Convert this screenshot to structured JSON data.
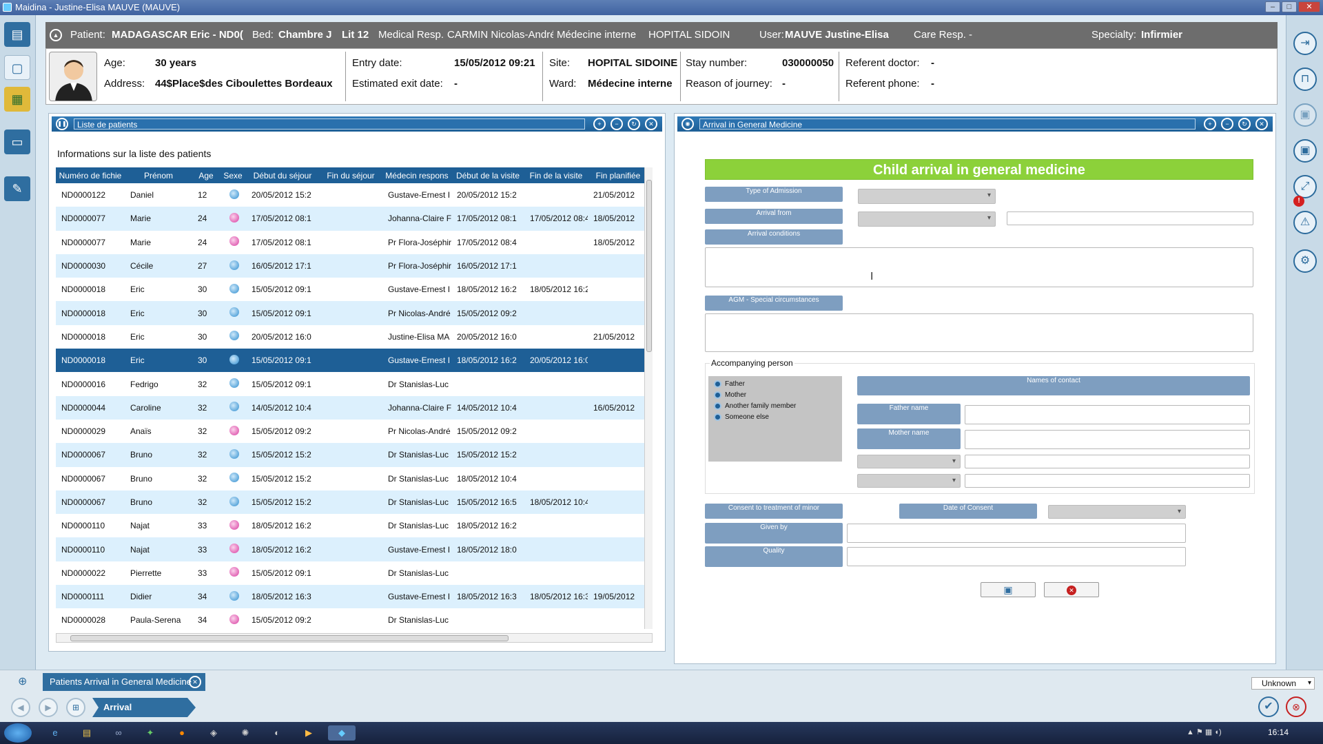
{
  "window": {
    "title": "Maidina - Justine-Elisa MAUVE (MAUVE)",
    "min": "–",
    "max": "□",
    "close": "✕"
  },
  "patient_bar": {
    "patient_label": "Patient:",
    "patient": "MADAGASCAR Eric - ND0(",
    "bed_label": "Bed:",
    "bed_room": "Chambre J",
    "bed_num": "Lit 12",
    "med_label": "Medical Resp.",
    "med_value": "CARMIN Nicolas-André",
    "ward": "Médecine interne",
    "hospital": "HOPITAL SIDOIN",
    "user_label": "User:",
    "user": "MAUVE Justine-Elisa",
    "care_label": "Care Resp.",
    "care_value": "-",
    "spec_label": "Specialty:",
    "spec_value": "Infirmier"
  },
  "info": {
    "age_label": "Age:",
    "age": "30 years",
    "address_label": "Address:",
    "address": "44$Place$des Ciboulettes Bordeaux",
    "entry_label": "Entry date:",
    "entry": "15/05/2012 09:21",
    "exit_label": "Estimated exit date:",
    "exit": "-",
    "site_label": "Site:",
    "site": "HOPITAL SIDOINE",
    "ward_label": "Ward:",
    "ward": "Médecine interne",
    "stay_label": "Stay number:",
    "stay": "030000050",
    "reason_label": "Reason of journey:",
    "reason": "-",
    "refdoc_label": "Referent doctor:",
    "refdoc": "-",
    "refphone_label": "Referent phone:",
    "refphone": "-"
  },
  "patients_panel": {
    "title": "Liste de patients",
    "subtitle": "Informations sur la liste des patients",
    "columns": [
      "Numéro de fichie",
      "Prénom",
      "Age",
      "Sexe",
      "Début du séjour",
      "Fin du séjour",
      "Médecin respons",
      "Début de la visite",
      "Fin de la visite",
      "Fin planifiée"
    ],
    "rows": [
      [
        "ND0000122",
        "Daniel",
        "12",
        "m",
        "20/05/2012 15:2",
        "",
        "Gustave-Ernest I",
        "20/05/2012 15:2",
        "",
        "21/05/2012"
      ],
      [
        "ND0000077",
        "Marie",
        "24",
        "f",
        "17/05/2012 08:1",
        "",
        "Johanna-Claire F",
        "17/05/2012 08:1",
        "17/05/2012 08:4",
        "18/05/2012"
      ],
      [
        "ND0000077",
        "Marie",
        "24",
        "f",
        "17/05/2012 08:1",
        "",
        "Pr Flora-Joséphir",
        "17/05/2012 08:4",
        "",
        "18/05/2012"
      ],
      [
        "ND0000030",
        "Cécile",
        "27",
        "m",
        "16/05/2012 17:1",
        "",
        "Pr Flora-Joséphir",
        "16/05/2012 17:1",
        "",
        ""
      ],
      [
        "ND0000018",
        "Eric",
        "30",
        "m",
        "15/05/2012 09:1",
        "",
        "Gustave-Ernest I",
        "18/05/2012 16:2",
        "18/05/2012 16:2",
        ""
      ],
      [
        "ND0000018",
        "Eric",
        "30",
        "m",
        "15/05/2012 09:1",
        "",
        "Pr Nicolas-André",
        "15/05/2012 09:2",
        "",
        ""
      ],
      [
        "ND0000018",
        "Eric",
        "30",
        "m",
        "20/05/2012 16:0",
        "",
        "Justine-Elisa MA",
        "20/05/2012 16:0",
        "",
        "21/05/2012"
      ],
      [
        "ND0000018",
        "Eric",
        "30",
        "m",
        "15/05/2012 09:1",
        "",
        "Gustave-Ernest I",
        "18/05/2012 16:2",
        "20/05/2012 16:0",
        ""
      ],
      [
        "ND0000016",
        "Fedrigo",
        "32",
        "m",
        "15/05/2012 09:1",
        "",
        "Dr Stanislas-Luc",
        "",
        "",
        ""
      ],
      [
        "ND0000044",
        "Caroline",
        "32",
        "m",
        "14/05/2012 10:4",
        "",
        "Johanna-Claire F",
        "14/05/2012 10:4",
        "",
        "16/05/2012"
      ],
      [
        "ND0000029",
        "Anaïs",
        "32",
        "f",
        "15/05/2012 09:2",
        "",
        "Pr Nicolas-André",
        "15/05/2012 09:2",
        "",
        ""
      ],
      [
        "ND0000067",
        "Bruno",
        "32",
        "m",
        "15/05/2012 15:2",
        "",
        "Dr Stanislas-Luc",
        "15/05/2012 15:2",
        "",
        ""
      ],
      [
        "ND0000067",
        "Bruno",
        "32",
        "m",
        "15/05/2012 15:2",
        "",
        "Dr Stanislas-Luc",
        "18/05/2012 10:4",
        "",
        ""
      ],
      [
        "ND0000067",
        "Bruno",
        "32",
        "m",
        "15/05/2012 15:2",
        "",
        "Dr Stanislas-Luc",
        "15/05/2012 16:5",
        "18/05/2012 10:4",
        ""
      ],
      [
        "ND0000110",
        "Najat",
        "33",
        "f",
        "18/05/2012 16:2",
        "",
        "Dr Stanislas-Luc",
        "18/05/2012 16:2",
        "",
        ""
      ],
      [
        "ND0000110",
        "Najat",
        "33",
        "f",
        "18/05/2012 16:2",
        "",
        "Gustave-Ernest I",
        "18/05/2012 18:0",
        "",
        ""
      ],
      [
        "ND0000022",
        "Pierrette",
        "33",
        "f",
        "15/05/2012 09:1",
        "",
        "Dr Stanislas-Luc",
        "",
        "",
        ""
      ],
      [
        "ND0000111",
        "Didier",
        "34",
        "m",
        "18/05/2012 16:3",
        "",
        "Gustave-Ernest I",
        "18/05/2012 16:3",
        "18/05/2012 16:3",
        "19/05/2012"
      ],
      [
        "ND0000028",
        "Paula-Serena",
        "34",
        "f",
        "15/05/2012 09:2",
        "",
        "Dr Stanislas-Luc",
        "",
        "",
        ""
      ]
    ],
    "selected_row": 7
  },
  "arrival_panel": {
    "title": "Arrival in General Medicine",
    "banner": "Child arrival in general medicine",
    "type_admission": "Type of Admission",
    "arrival_from": "Arrival from",
    "arrival_conditions": "Arrival conditions",
    "agm": "AGM - Special circumstances",
    "accompanying": "Accompanying person",
    "radios": [
      "Father",
      "Mother",
      "Another family member",
      "Someone else"
    ],
    "names_of_contact": "Names of contact",
    "father_name": "Father name",
    "mother_name": "Mother name",
    "consent": "Consent to treatment of minor",
    "date_consent": "Date of Consent",
    "given_by": "Given by",
    "quality": "Quality"
  },
  "bottom": {
    "tab": "Patients Arrival in General Medicine",
    "crumb": "Arrival",
    "status": "Unknown",
    "clock": "16:14"
  },
  "colors": {
    "header_blue": "#1e5f96",
    "banner_green": "#8cd13a",
    "field_blue": "#7e9ec0",
    "row_alt": "#dcf0fd"
  }
}
